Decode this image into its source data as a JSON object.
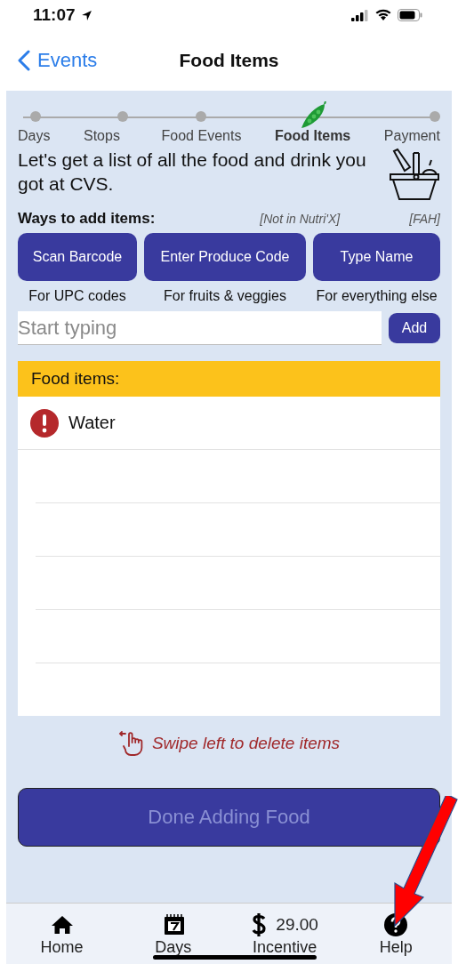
{
  "status_bar": {
    "time": "11:07"
  },
  "nav": {
    "back": "Events",
    "title": "Food Items"
  },
  "steps": [
    {
      "label": "Days",
      "selected": false
    },
    {
      "label": "Stops",
      "selected": false
    },
    {
      "label": "Food Events",
      "selected": false
    },
    {
      "label": "Food Items",
      "selected": true
    },
    {
      "label": "Payment",
      "selected": false
    }
  ],
  "intro": "Let's get a list of all the food and drink you got at CVS.",
  "ways": {
    "heading": "Ways to add items:",
    "note_1": "[Not in Nutri'X]",
    "note_2": "[FAH]"
  },
  "methods": [
    {
      "button": "Scan Barcode",
      "hint": "For UPC codes"
    },
    {
      "button": "Enter Produce Code",
      "hint": "For fruits & veggies"
    },
    {
      "button": "Type Name",
      "hint": "For everything else"
    }
  ],
  "search": {
    "placeholder": "Start typing",
    "button": "Add"
  },
  "food_list": {
    "heading": "Food items:",
    "items": [
      {
        "name": "Water",
        "warning": true
      }
    ]
  },
  "swipe_hint": "Swipe left to delete items",
  "done_button": {
    "label": "Done Adding Food",
    "disabled": true
  },
  "tab_bar": [
    {
      "label": "Home",
      "kind": "home"
    },
    {
      "label": "Days",
      "kind": "days"
    },
    {
      "label": "Incentive",
      "kind": "incentive",
      "amount": "29.00"
    },
    {
      "label": "Help",
      "kind": "help"
    }
  ]
}
